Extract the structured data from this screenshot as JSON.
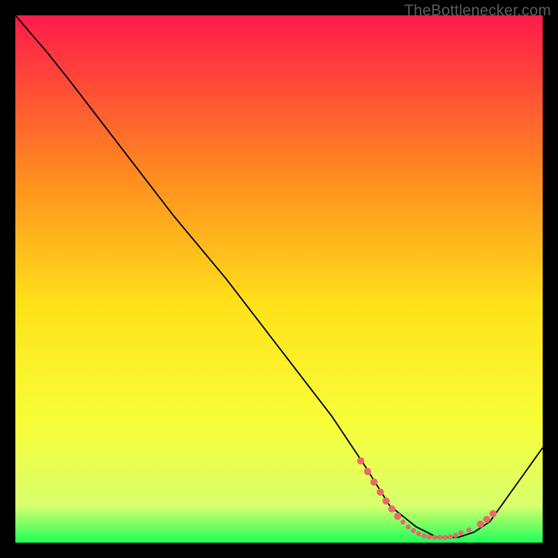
{
  "watermark": "TheBottleneсker.com",
  "chart_data": {
    "type": "line",
    "title": "",
    "xlabel": "",
    "ylabel": "",
    "xlim": [
      0,
      100
    ],
    "ylim": [
      0,
      100
    ],
    "grid": false,
    "background_gradient": {
      "top": "#ff1a4b",
      "mid_upper": "#ff8a1f",
      "mid": "#ffe21a",
      "mid_lower": "#f7ff3a",
      "near_bottom": "#d8ff6e",
      "bottom": "#1eff5a"
    },
    "series": [
      {
        "name": "bottleneck-curve",
        "x": [
          0,
          6,
          10,
          20,
          30,
          40,
          50,
          60,
          66,
          71,
          76,
          80,
          84,
          87,
          90,
          100
        ],
        "y": [
          100,
          93,
          88,
          75,
          62,
          50,
          37,
          24,
          15,
          7,
          3,
          1,
          1,
          2,
          4,
          18
        ],
        "stroke": "#000000",
        "width": 2
      }
    ],
    "markers": {
      "name": "highlight-dots",
      "color": "#e86a6a",
      "radius_small": 3.6,
      "radius_large": 5.2,
      "points": [
        {
          "x": 65.5,
          "y": 15.5,
          "r": "l"
        },
        {
          "x": 66.8,
          "y": 13.5,
          "r": "l"
        },
        {
          "x": 68.0,
          "y": 11.5,
          "r": "l"
        },
        {
          "x": 69.2,
          "y": 9.6,
          "r": "l"
        },
        {
          "x": 70.3,
          "y": 7.9,
          "r": "l"
        },
        {
          "x": 71.4,
          "y": 6.4,
          "r": "l"
        },
        {
          "x": 72.5,
          "y": 5.0,
          "r": "l"
        },
        {
          "x": 73.5,
          "y": 3.9,
          "r": "s"
        },
        {
          "x": 74.5,
          "y": 3.0,
          "r": "s"
        },
        {
          "x": 75.5,
          "y": 2.3,
          "r": "s"
        },
        {
          "x": 76.5,
          "y": 1.7,
          "r": "s"
        },
        {
          "x": 77.5,
          "y": 1.3,
          "r": "s"
        },
        {
          "x": 78.5,
          "y": 1.1,
          "r": "s"
        },
        {
          "x": 79.5,
          "y": 1.0,
          "r": "s"
        },
        {
          "x": 80.5,
          "y": 1.0,
          "r": "s"
        },
        {
          "x": 81.5,
          "y": 1.0,
          "r": "s"
        },
        {
          "x": 82.5,
          "y": 1.1,
          "r": "s"
        },
        {
          "x": 83.5,
          "y": 1.4,
          "r": "s"
        },
        {
          "x": 84.5,
          "y": 1.8,
          "r": "s"
        },
        {
          "x": 86.0,
          "y": 2.4,
          "r": "s"
        },
        {
          "x": 88.2,
          "y": 3.5,
          "r": "l"
        },
        {
          "x": 89.4,
          "y": 4.4,
          "r": "l"
        },
        {
          "x": 90.6,
          "y": 5.5,
          "r": "l"
        }
      ]
    }
  }
}
